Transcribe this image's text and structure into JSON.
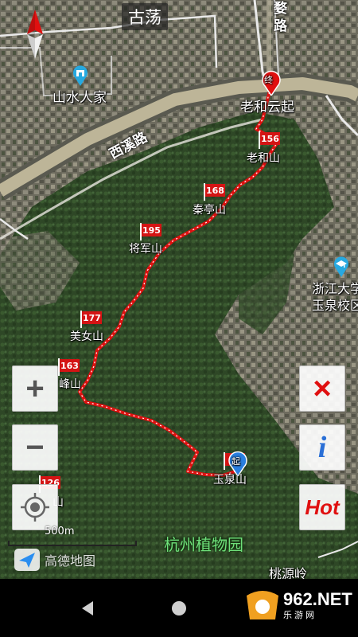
{
  "map": {
    "town_label": "古荡",
    "places": {
      "shanshui": "山水人家",
      "laohe_yunqi": "老和云起",
      "road_xixi": "西溪路",
      "road_top": "路",
      "road_top2": "婺",
      "zheda": "浙江大学",
      "zheda_campus": "玉泉校区",
      "botanical_garden": "杭州植物园",
      "taoyuan_ling": "桃源岭"
    },
    "peaks": [
      {
        "altitude": "156",
        "name": "老和山"
      },
      {
        "altitude": "168",
        "name": "秦亭山"
      },
      {
        "altitude": "195",
        "name": "将军山"
      },
      {
        "altitude": "177",
        "name": "美女山"
      },
      {
        "altitude": "163",
        "name": "峰山"
      },
      {
        "altitude": "126",
        "name": "山"
      },
      {
        "altitude": "",
        "name": "玉泉山"
      }
    ],
    "markers": {
      "end_label": "终",
      "start_label": "起"
    },
    "scale": "500m",
    "logo_text": "高德地图",
    "route_color": "#e01010"
  },
  "controls": {
    "zoom_in": "+",
    "zoom_out": "−",
    "close": "×",
    "info": "i",
    "hot": "Hot"
  },
  "watermark": {
    "number": "962.NET",
    "subtitle": "乐游网"
  },
  "colors": {
    "forest": "#2f4a26",
    "urban": "#6b6a5c",
    "road": "#d6c9a8",
    "accent_red": "#e01010",
    "info_blue": "#2a6fd6"
  }
}
